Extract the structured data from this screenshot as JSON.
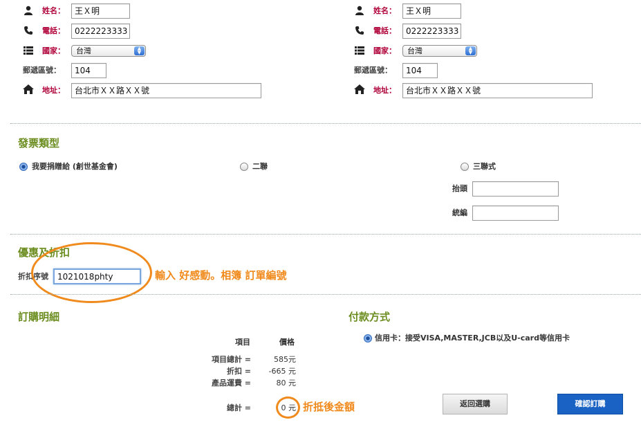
{
  "recipient_left": {
    "name_label": "姓名：",
    "name_value": "王Ｘ明",
    "phone_label": "電話：",
    "phone_value": "0222223333",
    "country_label": "國家：",
    "country_value": "台灣",
    "zip_label": "郵遞區號：",
    "zip_value": "104",
    "address_label": "地址：",
    "address_value": "台北市ＸＸ路ＸＸ號"
  },
  "recipient_right": {
    "name_label": "姓名：",
    "name_value": "王Ｘ明",
    "phone_label": "電話：",
    "phone_value": "0222223333",
    "country_label": "國家：",
    "country_value": "台灣",
    "zip_label": "郵遞區號：",
    "zip_value": "104",
    "address_label": "地址：",
    "address_value": "台北市ＸＸ路ＸＸ號"
  },
  "invoice": {
    "title": "發票類型",
    "options": [
      {
        "label": "我要捐贈給 (創世基金會)",
        "selected": true
      },
      {
        "label": "二聯",
        "selected": false
      },
      {
        "label": "三聯式",
        "selected": false
      }
    ],
    "header_label": "抬頭",
    "header_value": "",
    "tax_id_label": "統編",
    "tax_id_value": ""
  },
  "discount": {
    "title": "優惠及折扣",
    "code_label": "折扣序號",
    "code_value": "1021018phty",
    "annotation": "輸入 好感動。相簿 訂單編號"
  },
  "order": {
    "title": "訂購明細",
    "col_item": "項目",
    "col_price": "價格",
    "rows": [
      {
        "label": "項目總計 =",
        "value": "585元"
      },
      {
        "label": "折扣 =",
        "value": "-665 元"
      },
      {
        "label": "產品運費 =",
        "value": "80 元"
      }
    ],
    "total_label": "總計 =",
    "total_value": "0 元",
    "total_annotation": "折抵後金額"
  },
  "payment": {
    "title": "付款方式",
    "option_label": "信用卡：接受VISA,MASTER,JCB以及U-card等信用卡",
    "selected": true
  },
  "buttons": {
    "back": "返回選購",
    "confirm": "確認訂購"
  },
  "colors": {
    "section_title": "#6b8d1f",
    "required_label": "#b0003a",
    "annotation": "#f08a1c",
    "confirm_button": "#1a62c4"
  }
}
